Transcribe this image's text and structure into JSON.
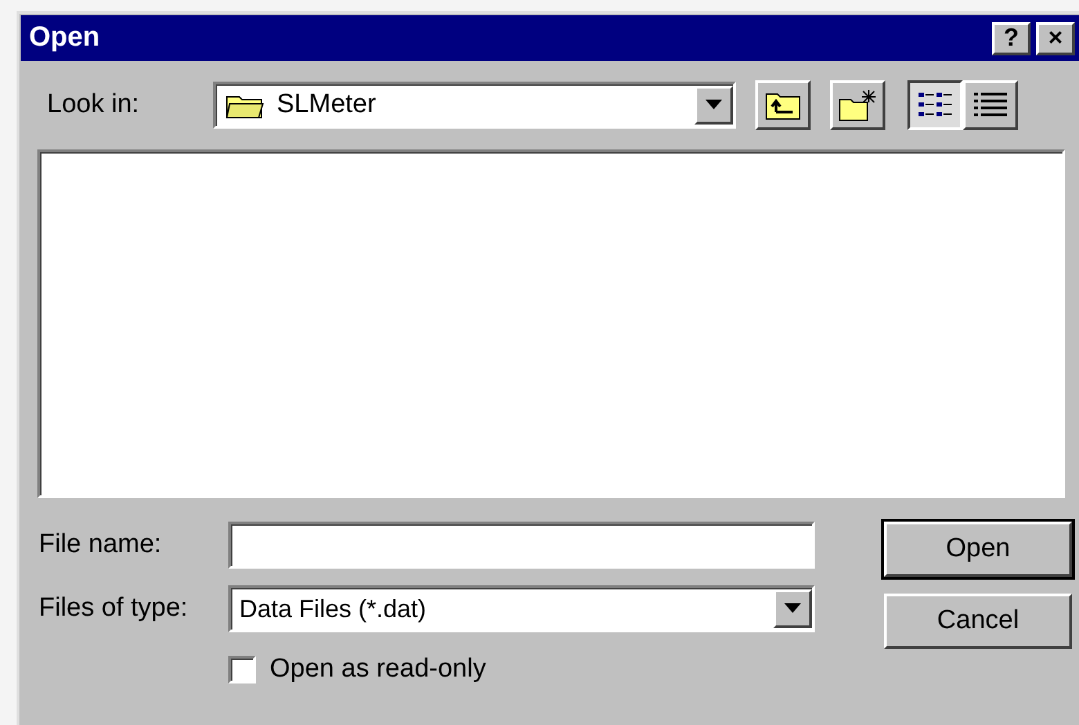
{
  "window": {
    "title": "Open",
    "title_buttons": [
      "?",
      "×"
    ]
  },
  "look_in": {
    "label": "Look in:",
    "value": "SLMeter"
  },
  "view_buttons": [
    {
      "kind": "list",
      "selected": true
    },
    {
      "kind": "details",
      "selected": false
    }
  ],
  "file_name": {
    "label": "File name:"
  },
  "files_of_type": {
    "label": "Files of type:",
    "value": "Data Files (*.dat)"
  },
  "read_only": {
    "label": "Open as read-only",
    "checked": false
  },
  "buttons": [
    {
      "label": "Open",
      "default": true
    },
    {
      "label": "Cancel",
      "default": false
    }
  ]
}
